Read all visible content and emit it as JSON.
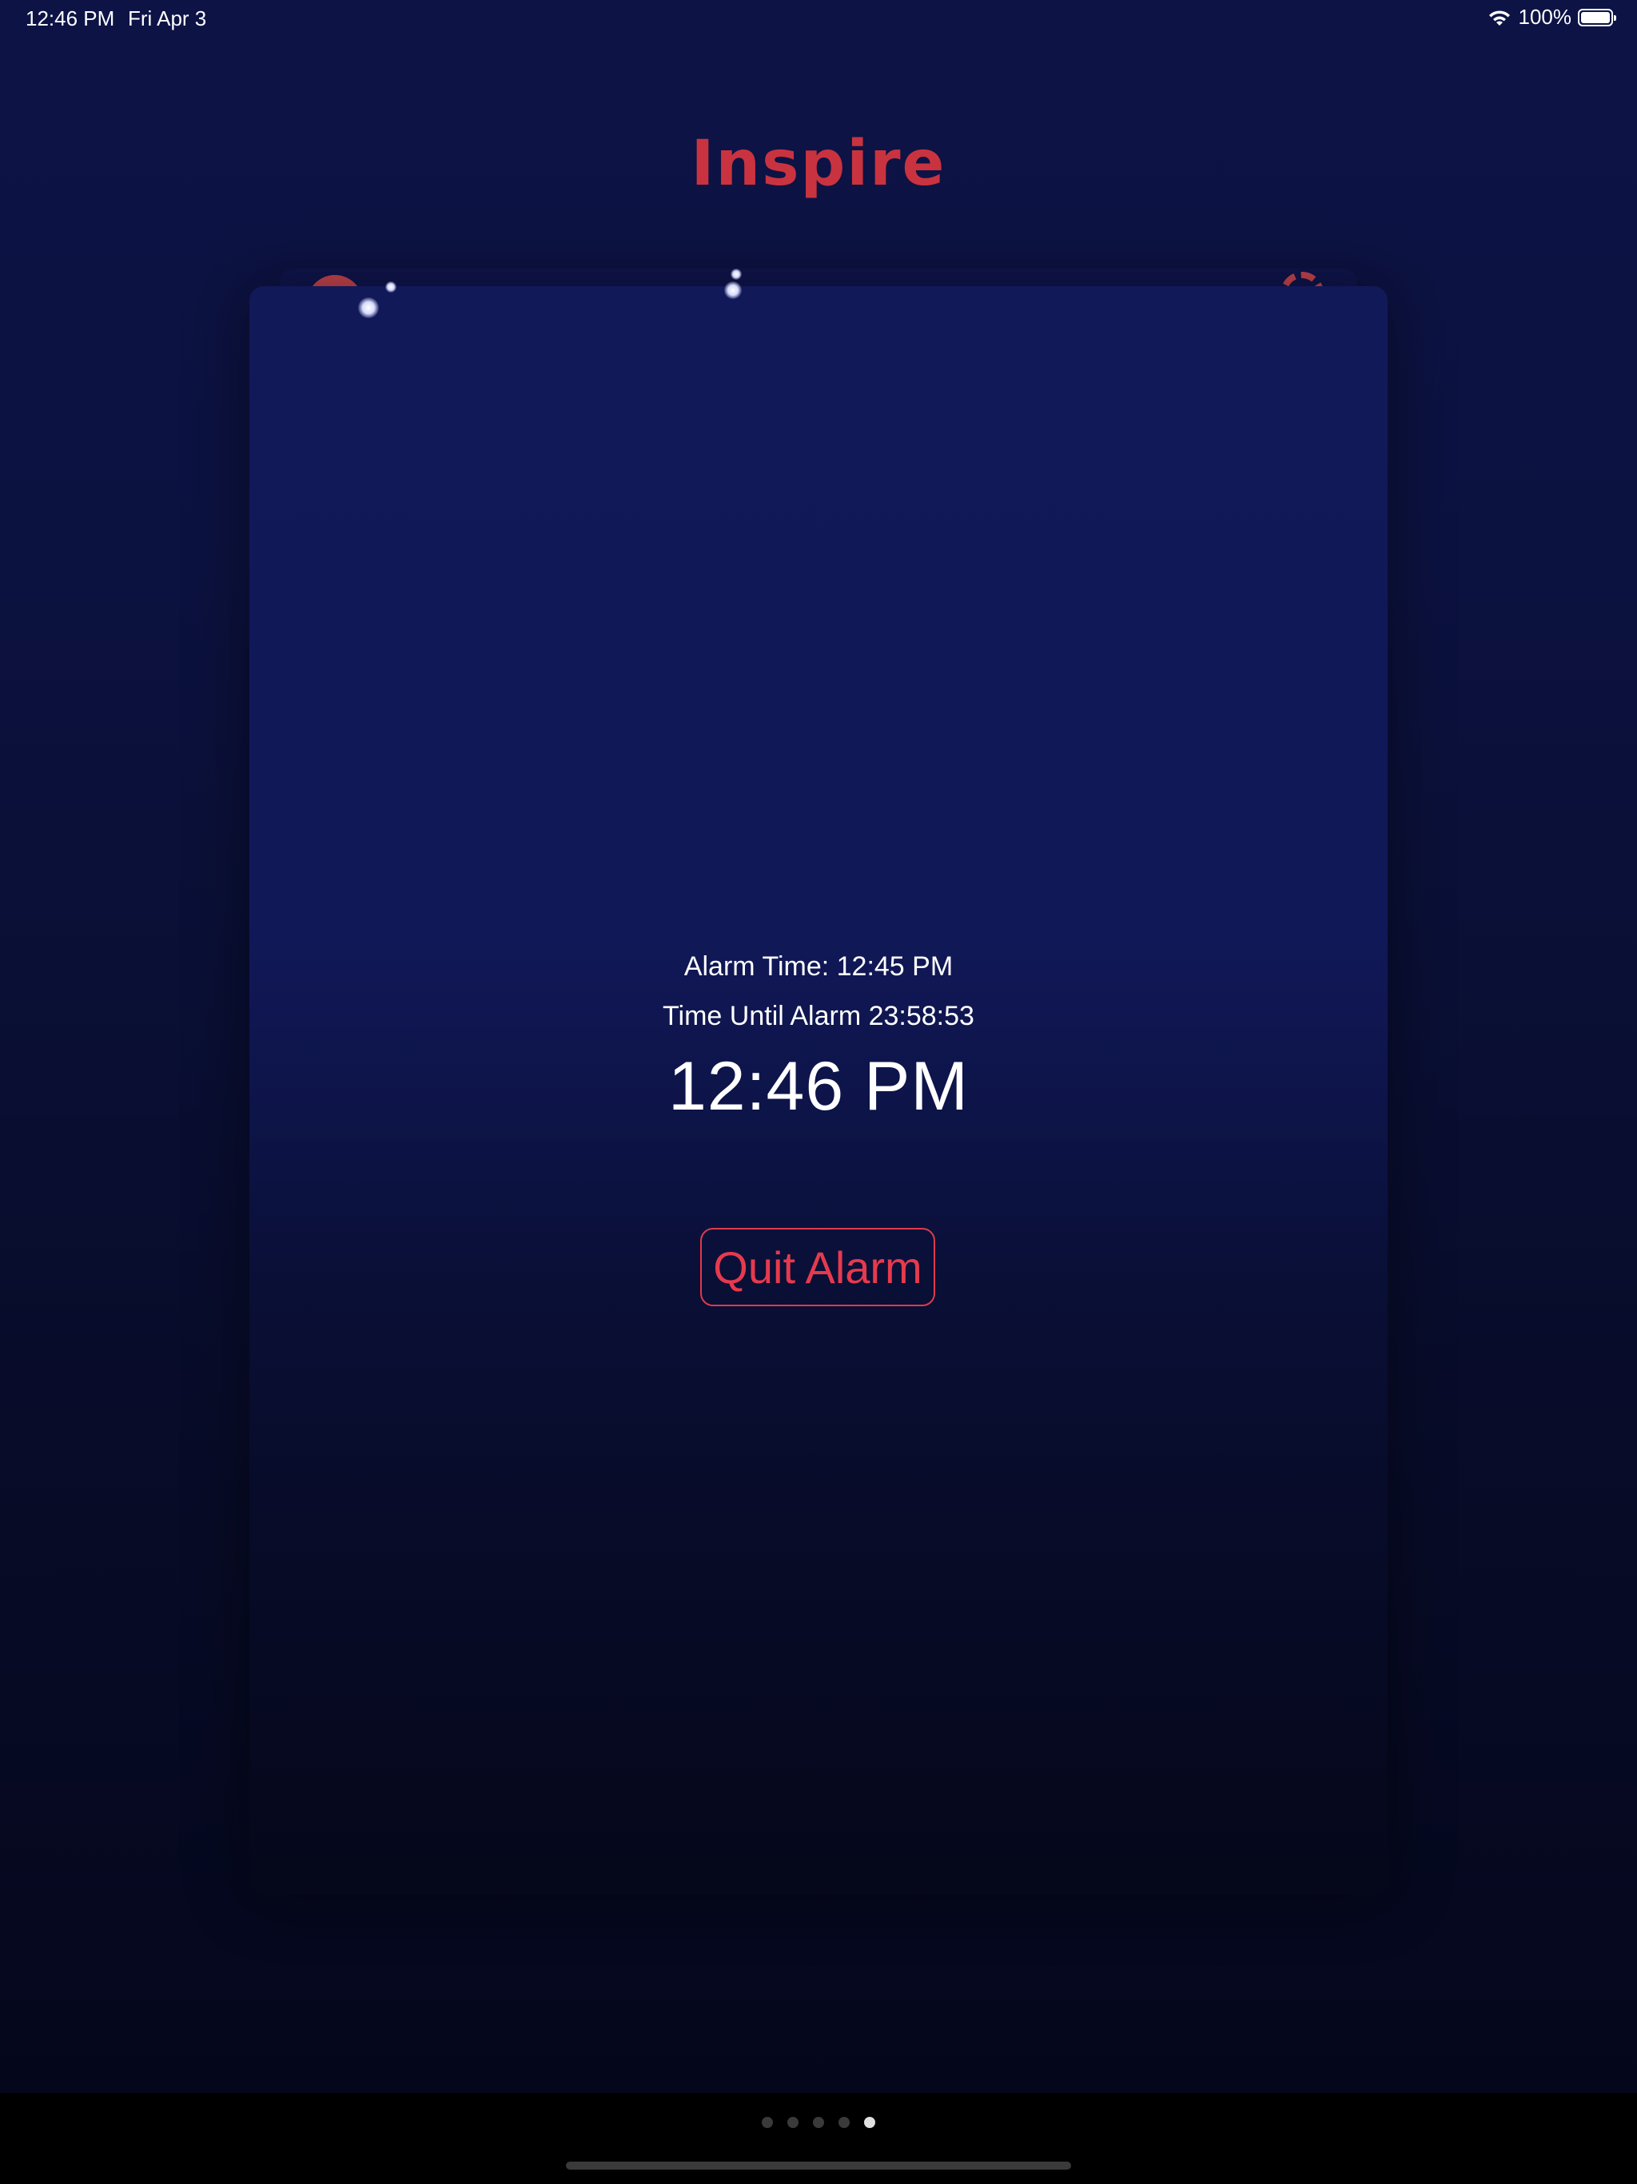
{
  "status_bar": {
    "time": "12:46 PM",
    "date": "Fri Apr 3",
    "battery": "100%",
    "battery_level": 1.0
  },
  "app": {
    "title": "Inspire"
  },
  "alarm": {
    "alarm_time_label": "Alarm Time: 12:45 PM",
    "time_until_label": "Time Until Alarm 23:58:53",
    "current_time": "12:46 PM",
    "quit_button_label": "Quit Alarm"
  },
  "pager": {
    "page_count": 5,
    "current_page": 5
  },
  "colors": {
    "accent": "#e63a4d",
    "title": "#c9333f",
    "background": "#0d1345"
  }
}
